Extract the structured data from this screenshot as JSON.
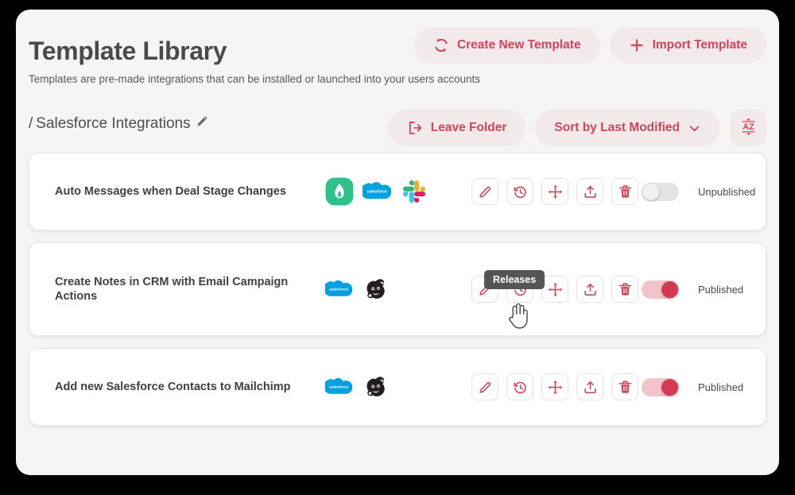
{
  "header": {
    "title": "Template Library",
    "subtitle": "Templates are pre-made integrations that can be installed or launched into your users accounts",
    "create_label": "Create New Template",
    "import_label": "Import Template",
    "create_icon": "refresh-cycle-icon",
    "import_icon": "plus-icon"
  },
  "folder": {
    "separator": "/",
    "name": "Salesforce Integrations",
    "edit_icon": "pencil-icon",
    "leave_label": "Leave Folder",
    "leave_icon": "exit-icon",
    "sort_label": "Sort by Last Modified",
    "sort_icon": "chevron-down-icon",
    "az_icon": "a-z-sort-icon",
    "az_label": "AZ"
  },
  "actions": {
    "edit": "Edit",
    "releases": "Releases",
    "move": "Move",
    "upload": "Upload",
    "delete": "Delete"
  },
  "tooltip": {
    "text": "Releases"
  },
  "colors": {
    "accent": "#d1455b",
    "accent_soft": "#f2e9ea",
    "toggle_on_track": "#f3c3cb",
    "toggle_on_knob": "#d33b55",
    "page_bg": "#f5f5f6",
    "row_bg": "#ffffff",
    "salesforce": "#00a1e0",
    "green_app": "#2ec28b",
    "slack_blue": "#36c5f0",
    "slack_green": "#2eb67d",
    "slack_red": "#e01e5a",
    "slack_yellow": "#ecb22e"
  },
  "rows": [
    {
      "title": "Auto Messages when Deal Stage Changes",
      "apps": [
        "green-app-icon",
        "salesforce-icon",
        "slack-icon"
      ],
      "status": "Unpublished",
      "published": false
    },
    {
      "title": "Create Notes in CRM with Email Campaign Actions",
      "apps": [
        "salesforce-icon",
        "mailchimp-icon"
      ],
      "status": "Published",
      "published": true
    },
    {
      "title": "Add new Salesforce Contacts to Mailchimp",
      "apps": [
        "salesforce-icon",
        "mailchimp-icon"
      ],
      "status": "Published",
      "published": true
    }
  ]
}
